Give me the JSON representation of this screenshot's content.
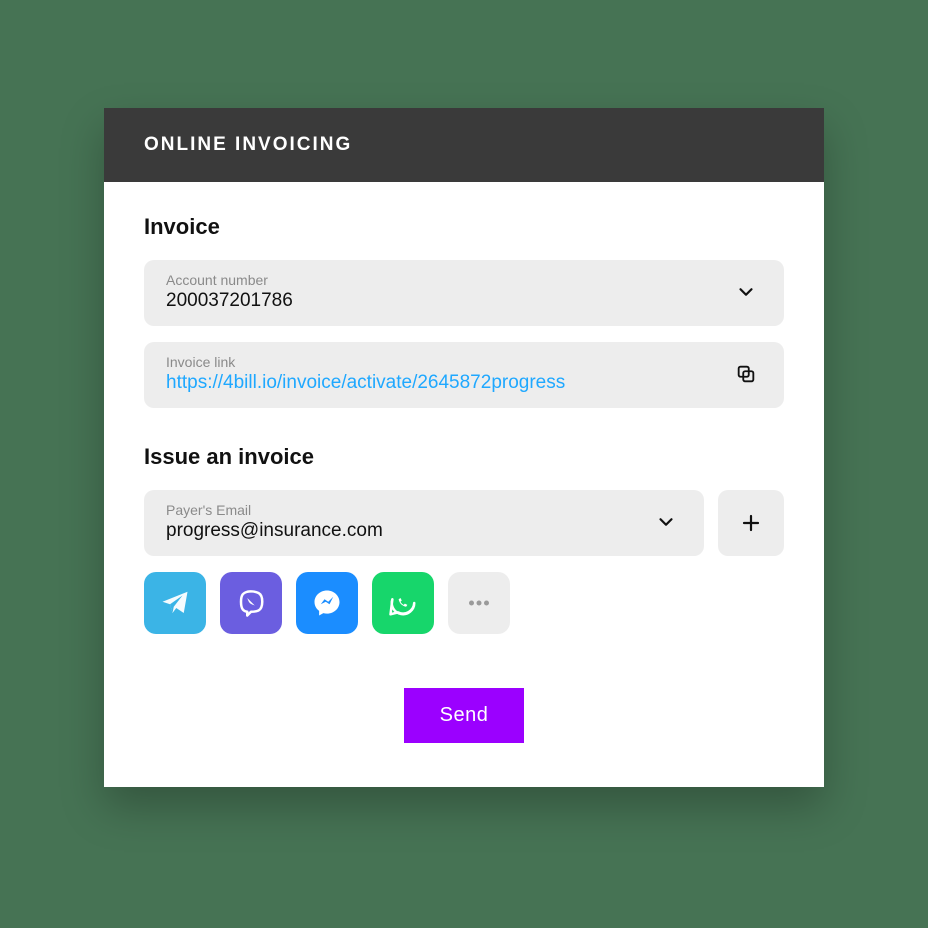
{
  "header": {
    "title": "ONLINE INVOICING"
  },
  "invoice": {
    "section_label": "Invoice",
    "account_number_label": "Account number",
    "account_number_value": "200037201786",
    "invoice_link_label": "Invoice link",
    "invoice_link_value": "https://4bill.io/invoice/activate/2645872progress"
  },
  "issue": {
    "section_label": "Issue an invoice",
    "payer_email_label": "Payer's Email",
    "payer_email_value": "progress@insurance.com"
  },
  "actions": {
    "send_label": "Send"
  },
  "share": {
    "options": [
      "telegram",
      "viber",
      "messenger",
      "whatsapp",
      "more"
    ]
  },
  "colors": {
    "accent": "#9b00ff",
    "link": "#1fa8ff",
    "telegram": "#3bb4e6",
    "viber": "#6b5ee0",
    "messenger": "#1b8dff",
    "whatsapp": "#17d66b"
  }
}
